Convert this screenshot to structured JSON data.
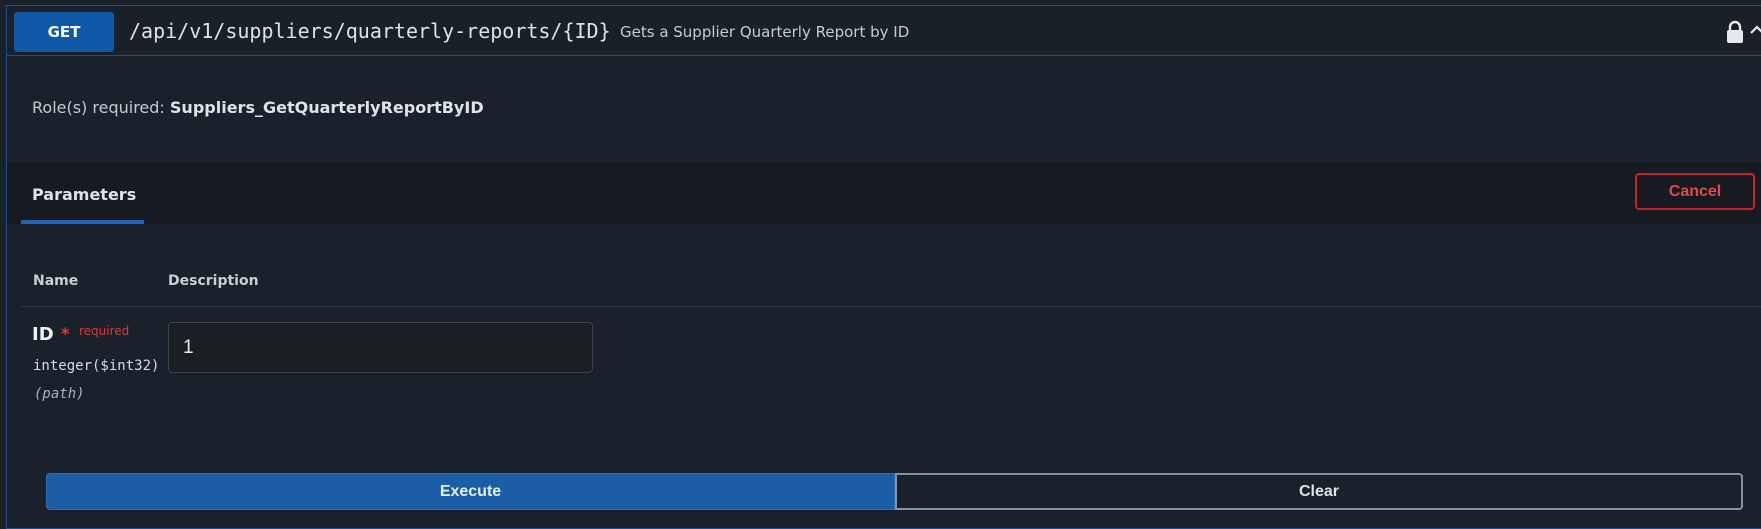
{
  "operation": {
    "method": "GET",
    "path": "/api/v1/suppliers/quarterly-reports/{ID}",
    "summary": "Gets a Supplier Quarterly Report by ID",
    "icons": {
      "lock": "lock-icon",
      "collapse": "chevron-up-icon"
    }
  },
  "roles": {
    "label": "Role(s) required:",
    "value": "Suppliers_GetQuarterlyReportByID"
  },
  "parameters": {
    "tab_label": "Parameters",
    "cancel_label": "Cancel",
    "columns": [
      "Name",
      "Description"
    ],
    "items": [
      {
        "name": "ID",
        "required_marker": "*",
        "required_label": "required",
        "type": "integer($int32)",
        "in": "(path)",
        "value": "1"
      }
    ]
  },
  "actions": {
    "execute_label": "Execute",
    "clear_label": "Clear"
  },
  "colors": {
    "method_bg": "#0f58a5",
    "cancel_border": "#c1242c",
    "execute_bg": "#1b5ea6"
  }
}
